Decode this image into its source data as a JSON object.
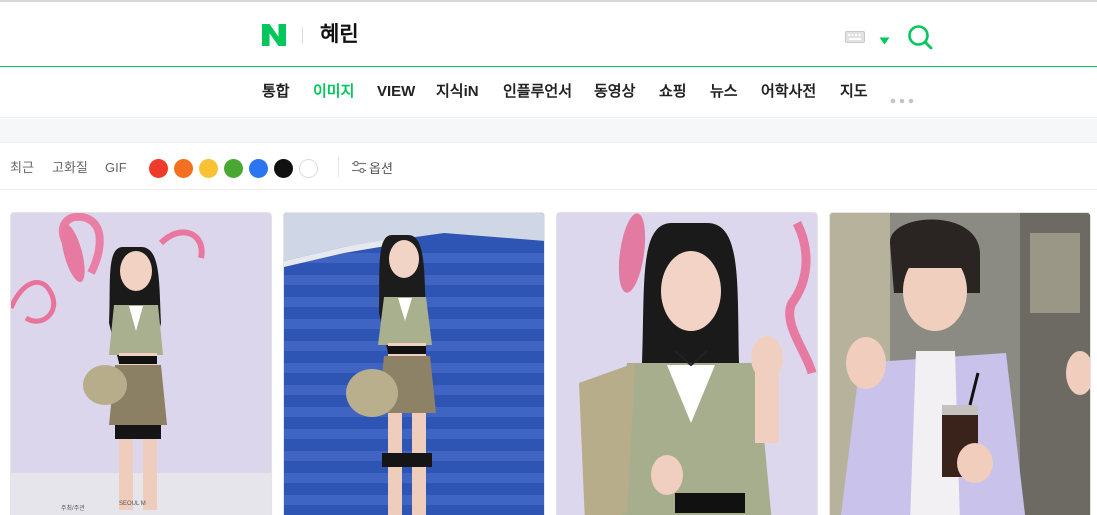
{
  "header": {
    "logo_text": "N",
    "query": "혜린",
    "logo_color": "#03c75a",
    "keyboard_icon": "keyboard-icon",
    "search_icon": "search-icon"
  },
  "tabs": [
    {
      "label": "통합",
      "active": false
    },
    {
      "label": "이미지",
      "active": true
    },
    {
      "label": "VIEW",
      "active": false
    },
    {
      "label": "지식iN",
      "active": false
    },
    {
      "label": "인플루언서",
      "active": false
    },
    {
      "label": "동영상",
      "active": false
    },
    {
      "label": "쇼핑",
      "active": false
    },
    {
      "label": "뉴스",
      "active": false
    },
    {
      "label": "어학사전",
      "active": false
    },
    {
      "label": "지도",
      "active": false
    }
  ],
  "filters": {
    "recent": "최근",
    "hd": "고화질",
    "gif": "GIF",
    "options": "옵션",
    "colors": [
      "#ef3b2c",
      "#f37021",
      "#f8c234",
      "#4aa832",
      "#2b76f0",
      "#111111",
      "#ffffff"
    ]
  },
  "accent_color": "#03c75a",
  "images": [
    {
      "name": "image-result-1",
      "background": "#dcd6ec"
    },
    {
      "name": "image-result-2",
      "background": "#2f55b4"
    },
    {
      "name": "image-result-3",
      "background": "#dcd7ec"
    },
    {
      "name": "image-result-4",
      "background": "#8b8b84"
    }
  ]
}
